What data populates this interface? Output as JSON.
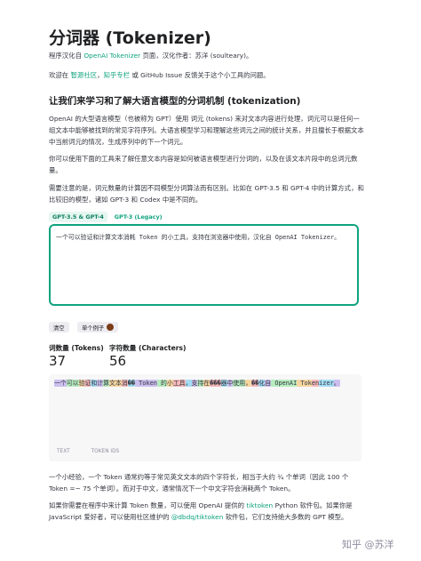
{
  "title": "分词器 (Tokenizer)",
  "intro": {
    "p1_a": "程序汉化自 ",
    "p1_link": "OpenAI Tokenizer",
    "p1_b": " 页面，汉化作者：苏洋 (soulteary)。",
    "p2_a": "欢迎在 ",
    "p2_link1": "智源社区",
    "p2_sep": "，",
    "p2_link2": "知乎专栏",
    "p2_b": " 或 GitHub Issue 反馈关于这个小工具的问题。"
  },
  "section_heading": "让我们来学习和了解大语言模型的分词机制 (tokenization)",
  "paragraphs": {
    "p3": "OpenAI 的大型语言模型（也被称为 GPT）使用 词元 (tokens) 来对文本内容进行处理，词元可以是任何一组文本中能够被找到的常见字符序列。大语言模型学习和理解这些词元之间的统计关系，并且擅长于根据文本中当前词元的情况，生成序列中的下一个词元。",
    "p4": "你可以使用下面的工具来了解任意文本内容是如何被语言模型进行分词的，以及在该文本片段中的总词元数量。",
    "p5": "需要注意的是，词元数量的计算因不同模型分词算法而有区别。比如在 GPT-3.5 和 GPT-4 中的计算方式，和比较旧的模型，诸如 GPT-3 和 Codex 中是不同的。"
  },
  "model_tabs": [
    "GPT-3.5 & GPT-4",
    "GPT-3 (Legacy)"
  ],
  "input": {
    "value": "一个可以验证和计算文本消耗 Token 的小工具，支持在浏览器中使用，汉化自 OpenAI Tokenizer。"
  },
  "buttons": {
    "clear": "清空",
    "example": "单个例子"
  },
  "stats": {
    "tokens_label": "词数量 (Tokens)",
    "tokens_value": "37",
    "chars_label": "字符数量 (Characters)",
    "chars_value": "56"
  },
  "token_segments": [
    "一个",
    "可以",
    "验",
    "证",
    "和",
    "计",
    "算",
    "文本",
    "消",
    "��",
    " Token",
    " 的",
    "小",
    "工具",
    "，",
    "支",
    "持",
    "在",
    "���",
    "器",
    "中",
    "使用",
    "，",
    "��",
    "化",
    "自",
    " OpenAI",
    " Tok",
    "en",
    "izer",
    "。"
  ],
  "view_options": [
    "TEXT",
    "TOKEN IDS"
  ],
  "paragraphs2": {
    "p6": "一个小经验，一个 Token 通常约等于常见英文文本的四个字符长，相当于大约 ¾ 个单词（因此 100 个 Token =~ 75 个单词）。而对于中文，通常情况下一个中文字符会消耗两个 Token。",
    "p7_a": "如果你需要在程序中来计算 Token 数量，可以使用 OpenAI 提供的 ",
    "p7_link1": "tiktoken",
    "p7_b": " Python 软件包。如果你是 JavaScript 爱好者，可以使用社区维护的 ",
    "p7_link2": "@dbdq/tiktoken",
    "p7_c": " 软件包，它们支持绝大多数的 GPT 模型。"
  },
  "watermark": "知乎 @苏洋",
  "colors": {
    "accent": "#10a37f",
    "token_palette": [
      "#6b40d8",
      "#68de7a",
      "#f4ac36",
      "#ef4146",
      "#27b5ea"
    ]
  },
  "icons": {
    "example_icon": "cookie-icon"
  }
}
